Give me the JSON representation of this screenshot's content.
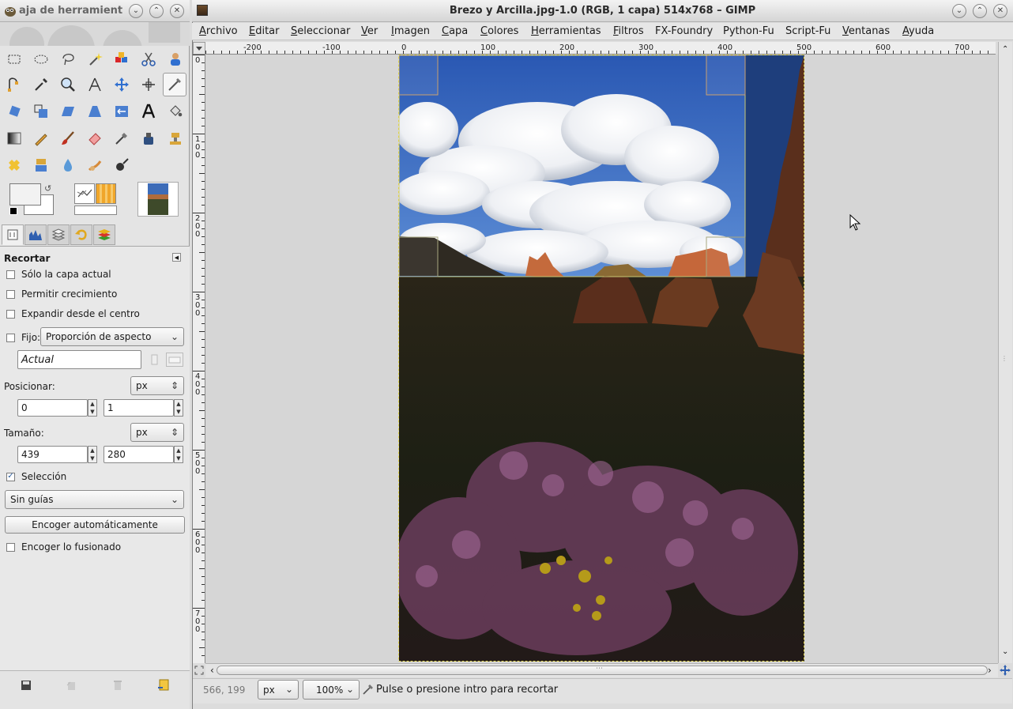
{
  "toolbox": {
    "title": "aja de herramient",
    "tab_tool_options": "tool-options",
    "options": {
      "title": "Recortar",
      "only_current_layer": "Sólo la capa actual",
      "allow_growing": "Permitir crecimiento",
      "expand_from_center": "Expandir desde el centro",
      "fixed_label": "Fijo:",
      "fixed_mode": "Proporción de aspecto",
      "aspect_value": "Actual",
      "position_label": "Posicionar:",
      "position_unit": "px",
      "position_x": "0",
      "position_y": "1",
      "size_label": "Tamaño:",
      "size_unit": "px",
      "size_w": "439",
      "size_h": "280",
      "selection_label": "Selección",
      "selection_checked": true,
      "guides": "Sin guías",
      "auto_shrink_button": "Encoger automáticamente",
      "shrink_merged": "Encoger lo fusionado"
    }
  },
  "window": {
    "title": "Brezo y Arcilla.jpg-1.0 (RGB, 1 capa) 514x768 – GIMP"
  },
  "menu": [
    {
      "u": "A",
      "rest": "rchivo"
    },
    {
      "u": "E",
      "rest": "ditar"
    },
    {
      "u": "S",
      "rest": "eleccionar"
    },
    {
      "u": "V",
      "rest": "er"
    },
    {
      "u": "I",
      "rest": "magen"
    },
    {
      "u": "C",
      "rest": "apa"
    },
    {
      "u": "C",
      "rest": "olores"
    },
    {
      "u": "H",
      "rest": "erramientas"
    },
    {
      "u": "F",
      "rest": "iltros"
    },
    {
      "u": "",
      "rest": "FX-Foundry"
    },
    {
      "u": "",
      "rest": "Python-Fu"
    },
    {
      "u": "",
      "rest": "Script-Fu"
    },
    {
      "u": "V",
      "rest": "entanas"
    },
    {
      "u": "A",
      "rest": "yuda"
    }
  ],
  "ruler": {
    "h_labels": [
      "-200",
      "-100",
      "0",
      "100",
      "200",
      "300",
      "400",
      "500",
      "600",
      "700"
    ],
    "v_labels": [
      "0",
      "100",
      "200",
      "300",
      "400",
      "500",
      "600",
      "700"
    ]
  },
  "status": {
    "coords": "566, 199",
    "unit": "px",
    "zoom": "100%",
    "message": "Pulse o presione intro para recortar"
  },
  "crop": {
    "x": 0,
    "y": 1,
    "w": 439,
    "h": 280,
    "image_w": 514,
    "image_h": 768
  },
  "colors": {
    "accent": "#2b5d9e",
    "crop_outline": "#c8c873",
    "image_border": "#e0d44a"
  }
}
